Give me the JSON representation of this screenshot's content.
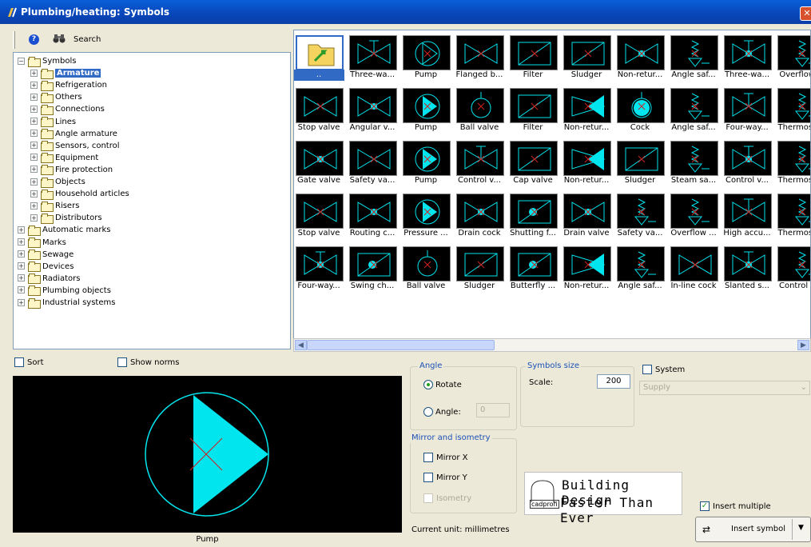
{
  "window": {
    "title": "Plumbing/heating: Symbols",
    "close_glyph": "✕"
  },
  "toolbar": {
    "search_label": "Search"
  },
  "tree": [
    {
      "label": "Symbols",
      "level": 0,
      "expanded": true
    },
    {
      "label": "Armature",
      "level": 1,
      "selected": true
    },
    {
      "label": "Refrigeration",
      "level": 1
    },
    {
      "label": "Others",
      "level": 1
    },
    {
      "label": "Connections",
      "level": 1
    },
    {
      "label": "Lines",
      "level": 1
    },
    {
      "label": "Angle armature",
      "level": 1
    },
    {
      "label": "Sensors, control",
      "level": 1
    },
    {
      "label": "Equipment",
      "level": 1
    },
    {
      "label": "Fire protection",
      "level": 1
    },
    {
      "label": "Objects",
      "level": 1
    },
    {
      "label": "Household articles",
      "level": 1
    },
    {
      "label": "Risers",
      "level": 1
    },
    {
      "label": "Distributors",
      "level": 1
    },
    {
      "label": "Automatic marks",
      "level": 0
    },
    {
      "label": "Marks",
      "level": 0
    },
    {
      "label": "Sewage",
      "level": 0
    },
    {
      "label": "Devices",
      "level": 0
    },
    {
      "label": "Radiators",
      "level": 0
    },
    {
      "label": "Plumbing objects",
      "level": 0
    },
    {
      "label": "Industrial systems",
      "level": 0
    }
  ],
  "symbols": [
    [
      "..",
      "Three-wa...",
      "Pump",
      "Flanged b...",
      "Filter",
      "Sludger",
      "Non-retur...",
      "Angle saf...",
      "Three-wa...",
      "Overflow..."
    ],
    [
      "Stop valve",
      "Angular v...",
      "Pump",
      "Ball valve",
      "Filter",
      "Non-retur...",
      "Cock",
      "Angle saf...",
      "Four-way...",
      "Thermost..."
    ],
    [
      "Gate valve",
      "Safety va...",
      "Pump",
      "Control v...",
      "Cap valve",
      "Non-retur...",
      "Sludger",
      "Steam sa...",
      "Control v...",
      "Thermost..."
    ],
    [
      "Stop valve",
      "Routing c...",
      "Pressure ...",
      "Drain cock",
      "Shutting f...",
      "Drain valve",
      "Safety va...",
      "Overflow ...",
      "High accu...",
      "Thermost..."
    ],
    [
      "Four-way...",
      "Swing ch...",
      "Ball valve",
      "Sludger",
      "Butterfly ...",
      "Non-retur...",
      "Angle saf...",
      "In-line cock",
      "Slanted s...",
      "Control v..."
    ]
  ],
  "options": {
    "sort_label": "Sort",
    "show_norms_label": "Show norms",
    "preview_label": "Pump",
    "angle_group": "Angle",
    "rotate_label": "Rotate",
    "angle_label": "Angle:",
    "angle_value": "0",
    "size_group": "Symbols size",
    "scale_label": "Scale:",
    "scale_value": "200",
    "system_label": "System",
    "system_value": "Supply",
    "mirror_group": "Mirror and isometry",
    "mirror_x": "Mirror X",
    "mirror_y": "Mirror Y",
    "isometry": "Isometry",
    "current_unit": "Current unit: millimetres",
    "logo_brand": "cadprofi",
    "logo_line1": "Building Design",
    "logo_line2": "Faster Than Ever",
    "insert_multiple": "Insert multiple",
    "insert_symbol": "Insert symbol"
  },
  "colors": {
    "symbol": "#00e5ee",
    "mark": "#d02020"
  }
}
